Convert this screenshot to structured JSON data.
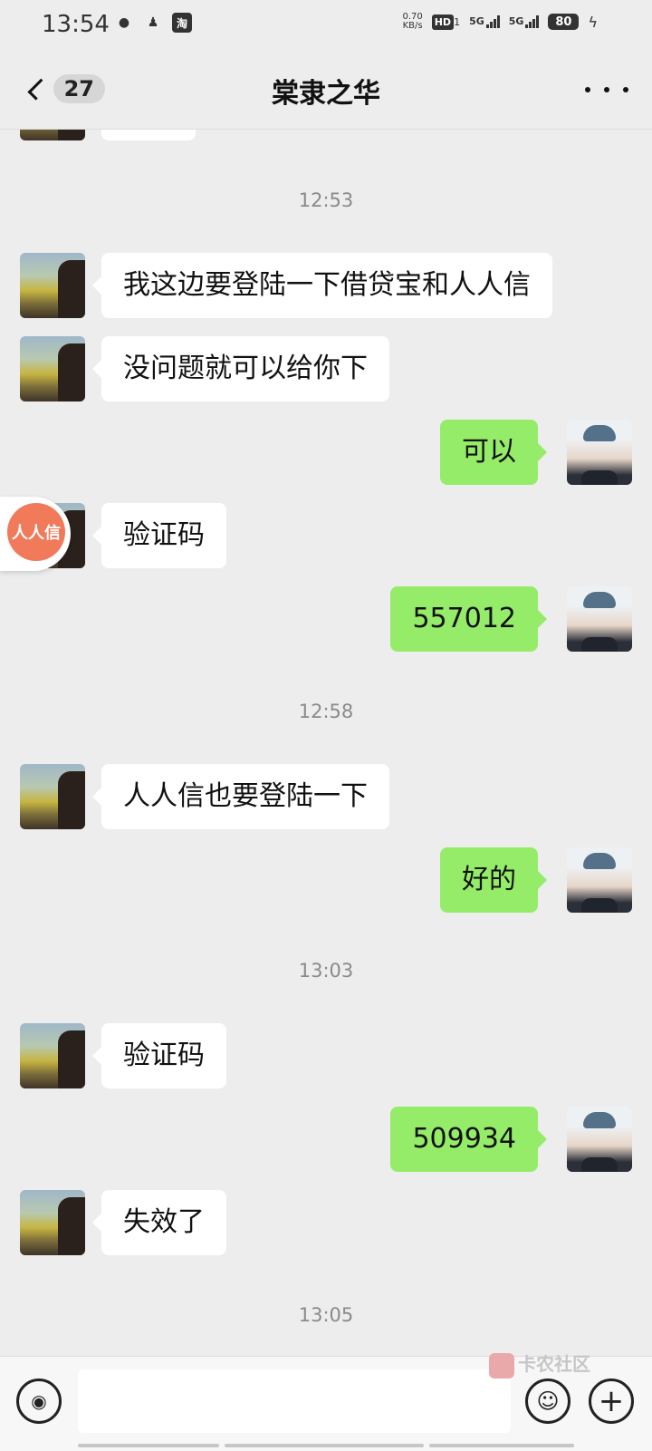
{
  "status_bar": {
    "time": "13:54",
    "app_icons": [
      "wechat-icon",
      "qq-icon",
      "taobao-icon"
    ],
    "taobao_label": "淘",
    "speed_value": "0.70",
    "speed_unit": "KB/s",
    "hd_label": "HD",
    "hd_sub": "1",
    "signal1_label": "5G",
    "signal2_label": "5G",
    "battery": "80"
  },
  "nav": {
    "unread_count": "27",
    "title": "棠隶之华"
  },
  "float_app": {
    "label": "人人信"
  },
  "messages": [
    {
      "type": "timestamp",
      "text": "12:53"
    },
    {
      "type": "peer",
      "text": "我这边要登陆一下借贷宝和人人信"
    },
    {
      "type": "peer",
      "text": "没问题就可以给你下"
    },
    {
      "type": "self",
      "text": "可以"
    },
    {
      "type": "peer",
      "text": "验证码"
    },
    {
      "type": "self",
      "text": "557012"
    },
    {
      "type": "timestamp",
      "text": "12:58"
    },
    {
      "type": "peer",
      "text": "人人信也要登陆一下"
    },
    {
      "type": "self",
      "text": "好的"
    },
    {
      "type": "timestamp",
      "text": "13:03"
    },
    {
      "type": "peer",
      "text": "验证码"
    },
    {
      "type": "self",
      "text": "509934"
    },
    {
      "type": "peer",
      "text": "失效了"
    },
    {
      "type": "timestamp",
      "text": "13:05"
    }
  ],
  "input_bar": {
    "watermark": "卡农社区"
  },
  "colors": {
    "background": "#ededed",
    "self_bubble": "#95ec69",
    "peer_bubble": "#ffffff",
    "timestamp": "#8a8a8a"
  }
}
